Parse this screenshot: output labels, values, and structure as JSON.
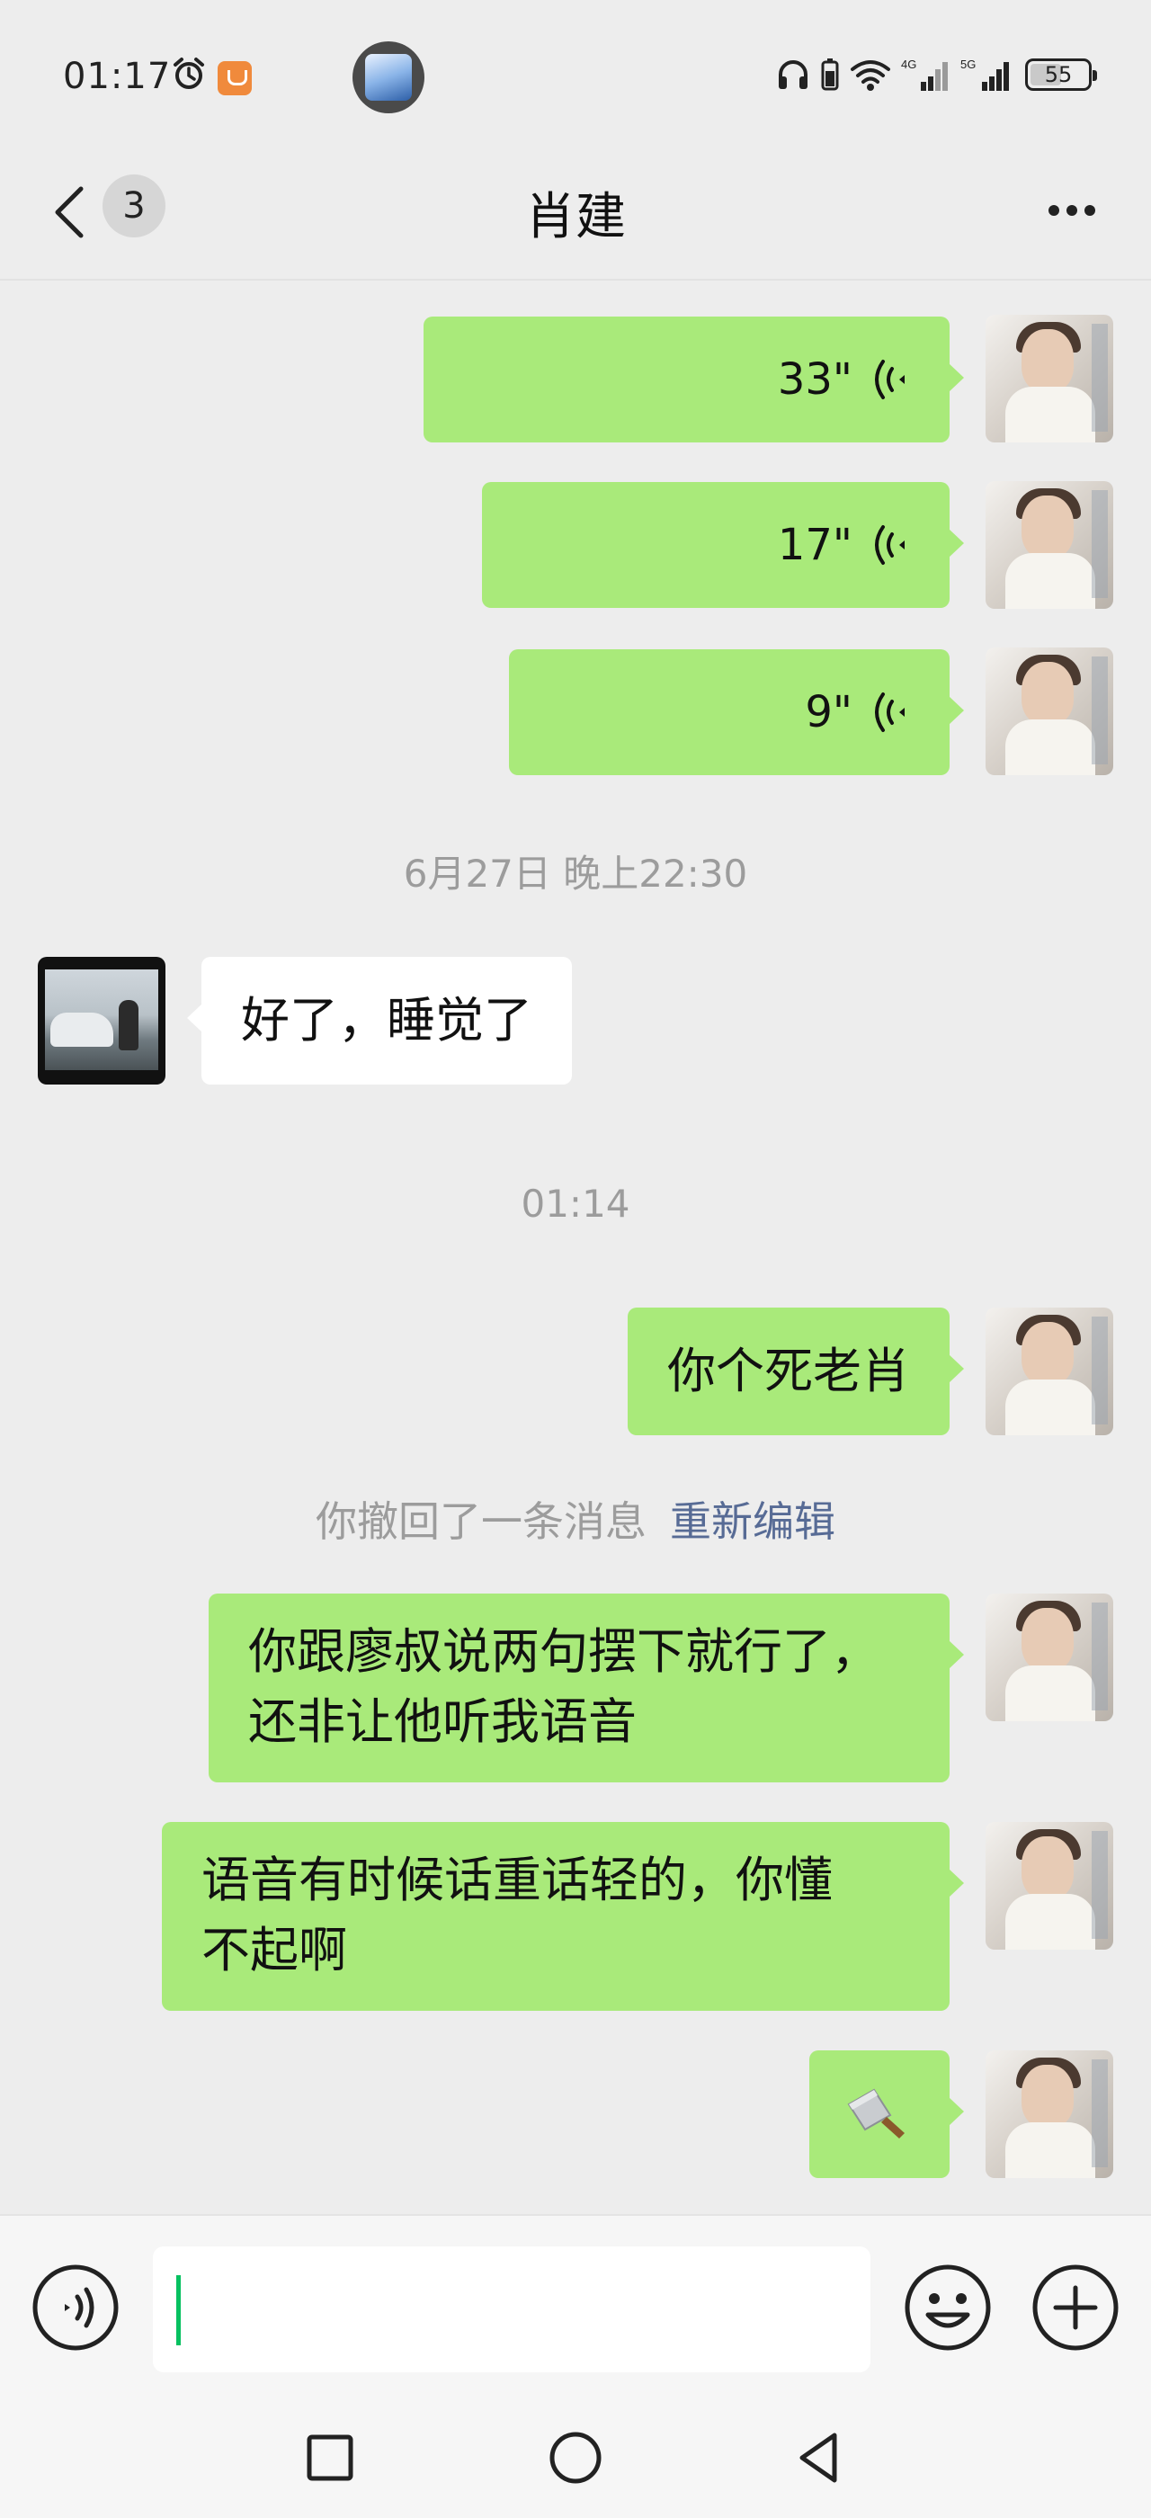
{
  "status_bar": {
    "time": "01:17",
    "battery": "55",
    "battery_level": 0.55,
    "signal_1": "4G",
    "signal_2": "5G",
    "icons": [
      "alarm-icon",
      "app-badge-icon",
      "headphones-icon",
      "battery-small-icon",
      "wifi-icon",
      "signal-4g-icon",
      "signal-5g-icon",
      "battery-icon"
    ]
  },
  "nav": {
    "back_icon": "chevron-left-icon",
    "unread_count": "3",
    "title": "肖建",
    "more_icon": "more-dots-icon"
  },
  "messages": [
    {
      "type": "voice",
      "from": "me",
      "duration": "33\""
    },
    {
      "type": "voice",
      "from": "me",
      "duration": "17\""
    },
    {
      "type": "voice",
      "from": "me",
      "duration": "9\""
    },
    {
      "type": "timestamp",
      "text": "6月27日 晚上22:30"
    },
    {
      "type": "text",
      "from": "friend",
      "text": "好了，睡觉了"
    },
    {
      "type": "timestamp",
      "text": "01:14"
    },
    {
      "type": "text",
      "from": "me",
      "text": "你个死老肖"
    },
    {
      "type": "recall",
      "text": "你撤回了一条消息",
      "action": "重新编辑"
    },
    {
      "type": "text",
      "from": "me",
      "lines": [
        "你跟廖叔说两句摆下就行了，",
        "还非让他听我语音"
      ]
    },
    {
      "type": "text",
      "from": "me",
      "lines": [
        "语音有时候话重话轻的，你懂",
        "不起啊"
      ]
    },
    {
      "type": "emoji",
      "from": "me",
      "icon": "cleaver-knife-icon"
    }
  ],
  "input_bar": {
    "voice_icon": "voice-input-icon",
    "text_value": "",
    "emoji_icon": "emoji-icon",
    "plus_icon": "plus-icon"
  },
  "system_nav": {
    "icons": [
      "recents-square-icon",
      "home-circle-icon",
      "back-triangle-icon"
    ]
  },
  "colors": {
    "background": "#ededed",
    "bubble_me": "#a9ea7a",
    "bubble_friend": "#ffffff",
    "link": "#576b95",
    "cursor": "#07c160"
  }
}
